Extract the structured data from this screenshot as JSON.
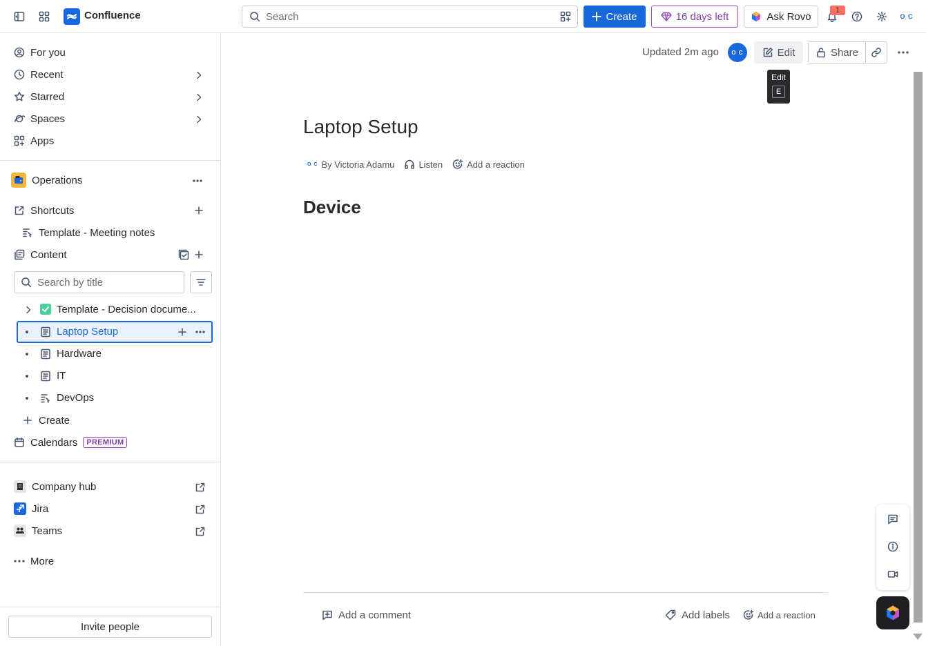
{
  "header": {
    "app_name": "Confluence",
    "search_placeholder": "Search",
    "create_label": "Create",
    "trial_label": "16 days left",
    "rovo_label": "Ask Rovo",
    "notification_count": "1",
    "profile_initials": "O C"
  },
  "sidebar": {
    "nav": [
      {
        "label": "For you"
      },
      {
        "label": "Recent"
      },
      {
        "label": "Starred"
      },
      {
        "label": "Spaces"
      },
      {
        "label": "Apps"
      }
    ],
    "space_name": "Operations",
    "shortcuts_label": "Shortcuts",
    "shortcut_items": [
      {
        "label": "Template - Meeting notes"
      }
    ],
    "content_label": "Content",
    "search_placeholder": "Search by title",
    "tree": [
      {
        "label": "Template - Decision docume...",
        "emoji": "✅"
      },
      {
        "label": "Laptop Setup"
      },
      {
        "label": "Hardware"
      },
      {
        "label": "IT"
      },
      {
        "label": "DevOps"
      }
    ],
    "create_label": "Create",
    "calendars_label": "Calendars",
    "premium_badge": "PREMIUM",
    "links": [
      {
        "label": "Company hub"
      },
      {
        "label": "Jira"
      },
      {
        "label": "Teams"
      }
    ],
    "more_label": "More",
    "invite_label": "Invite people"
  },
  "page": {
    "updated": "Updated 2m ago",
    "author_initials": "O C",
    "edit_label": "Edit",
    "share_label": "Share",
    "tooltip_title": "Edit",
    "tooltip_key": "E",
    "title": "Laptop Setup",
    "byline_author": "By Victoria Adamu",
    "listen_label": "Listen",
    "reaction_label": "Add a reaction",
    "heading": "Device",
    "comment_label": "Add a comment",
    "labels_label": "Add labels",
    "footer_reaction_label": "Add a reaction"
  },
  "colors": {
    "brand": "#1868db",
    "trial": "#803fa5",
    "space_icon": "#f5b43a"
  }
}
